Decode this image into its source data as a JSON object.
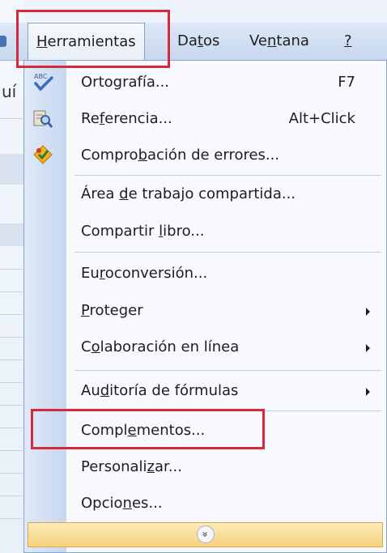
{
  "menubar": {
    "items": [
      {
        "pre": "",
        "u": "H",
        "post": "erramientas"
      },
      {
        "pre": "Da",
        "u": "t",
        "post": "os"
      },
      {
        "pre": "Ve",
        "u": "n",
        "post": "tana"
      },
      {
        "pre": "",
        "u": "?",
        "post": ""
      }
    ]
  },
  "background": {
    "edge_text": "uí"
  },
  "menu": {
    "items": [
      {
        "pre": "Ortografía...",
        "u": "",
        "post": "",
        "shortcut": "F7",
        "icon": "spelling-check-icon"
      },
      {
        "pre": "Re",
        "u": "f",
        "post": "erencia...",
        "shortcut": "Alt+Click",
        "icon": "research-icon"
      },
      {
        "pre": "Compro",
        "u": "b",
        "post": "ación de errores...",
        "shortcut": "",
        "icon": "error-check-icon"
      },
      {
        "pre": "Área ",
        "u": "d",
        "post": "e trabajo compartida...",
        "shortcut": ""
      },
      {
        "pre": "Compartir ",
        "u": "l",
        "post": "ibro...",
        "shortcut": ""
      },
      {
        "pre": "Eu",
        "u": "r",
        "post": "oconversión...",
        "shortcut": ""
      },
      {
        "pre": "",
        "u": "P",
        "post": "roteger",
        "shortcut": "",
        "submenu": true
      },
      {
        "pre": "C",
        "u": "o",
        "post": "laboración en línea",
        "shortcut": "",
        "submenu": true
      },
      {
        "pre": "Au",
        "u": "d",
        "post": "itoría de fórmulas",
        "shortcut": "",
        "submenu": true
      },
      {
        "pre": "Compl",
        "u": "e",
        "post": "mentos...",
        "shortcut": ""
      },
      {
        "pre": "Personali",
        "u": "z",
        "post": "ar...",
        "shortcut": ""
      },
      {
        "pre": "Opcio",
        "u": "n",
        "post": "es...",
        "shortcut": ""
      }
    ],
    "expand_glyph": "»"
  },
  "colors": {
    "highlight": "#d42a3b",
    "icon_column": "#c6d7ef",
    "expand_bar": "#f7d27c"
  }
}
